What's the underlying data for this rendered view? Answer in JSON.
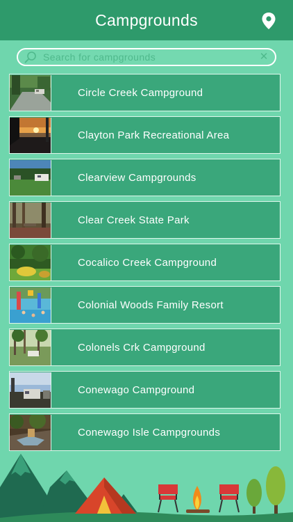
{
  "header": {
    "title": "Campgrounds"
  },
  "search": {
    "placeholder": "Search for campgrounds"
  },
  "campgrounds": [
    {
      "name": "Circle Creek Campground"
    },
    {
      "name": "Clayton Park Recreational Area"
    },
    {
      "name": "Clearview Campgrounds"
    },
    {
      "name": "Clear Creek State Park"
    },
    {
      "name": "Cocalico Creek Campground"
    },
    {
      "name": "Colonial Woods Family Resort"
    },
    {
      "name": "Colonels Crk Campground"
    },
    {
      "name": "Conewago Campground"
    },
    {
      "name": "Conewago Isle Campgrounds"
    }
  ],
  "icons": {
    "header": "map-pin-icon",
    "search": "search-icon",
    "clear": "clear-icon"
  },
  "colors": {
    "background": "#6fd6ad",
    "header": "#2e9a6b",
    "row": "#3aa77b"
  }
}
